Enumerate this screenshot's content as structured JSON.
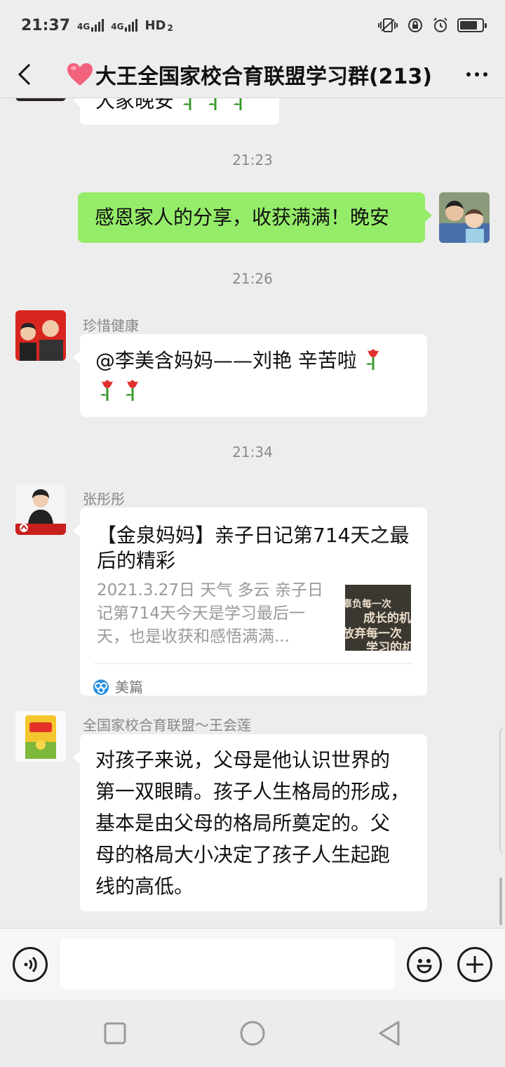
{
  "status_bar": {
    "time": "21:37",
    "network_1": "4G",
    "network_2": "4G",
    "hd_label": "HD",
    "hd_sub": "2",
    "battery_level": 0.7
  },
  "header": {
    "title": "大王全国家校合育联盟学习群(213)",
    "heart_icon": "heart-emoji",
    "more_icon": "ellipsis"
  },
  "messages": {
    "partial_top": {
      "text": "大家晚安"
    },
    "ts1": "21:23",
    "self_msg": {
      "text": "感恩家人的分享，收获满满！晚安"
    },
    "ts2": "21:26",
    "msg_zhenxi": {
      "sender": "珍惜健康",
      "line1": "@李美含妈妈——刘艳  辛苦啦",
      "line2": ""
    },
    "ts3": "21:34",
    "msg_zhang": {
      "sender": "张彤彤",
      "card_title": "【金泉妈妈】亲子日记第714天之最后的精彩",
      "card_desc": "2021.3.27日 天气 多云 亲子日记第714天今天是学习最后一天，也是收获和感悟满满...",
      "thumb_text_1": "辜负每一次",
      "thumb_text_2": "成长的机会",
      "thumb_text_3": "放弃每一次",
      "thumb_text_4": "学习的机会",
      "source": "美篇"
    },
    "msg_wang": {
      "sender": "全国家校合育联盟～王会莲",
      "line1": "对孩子来说，父母是他认识世界的",
      "line2": "第一双眼睛。孩子人生格局的形成，",
      "line3": "基本是由父母的格局所奠定的。父",
      "line4": "母的格局大小决定了孩子人生起跑",
      "line5": "线的高低。"
    }
  },
  "input_bar": {
    "voice_icon": "voice-icon",
    "emoji_icon": "emoji-icon",
    "plus_icon": "plus-icon"
  },
  "colors": {
    "self_bubble": "#95ec69",
    "background": "#ededed"
  }
}
